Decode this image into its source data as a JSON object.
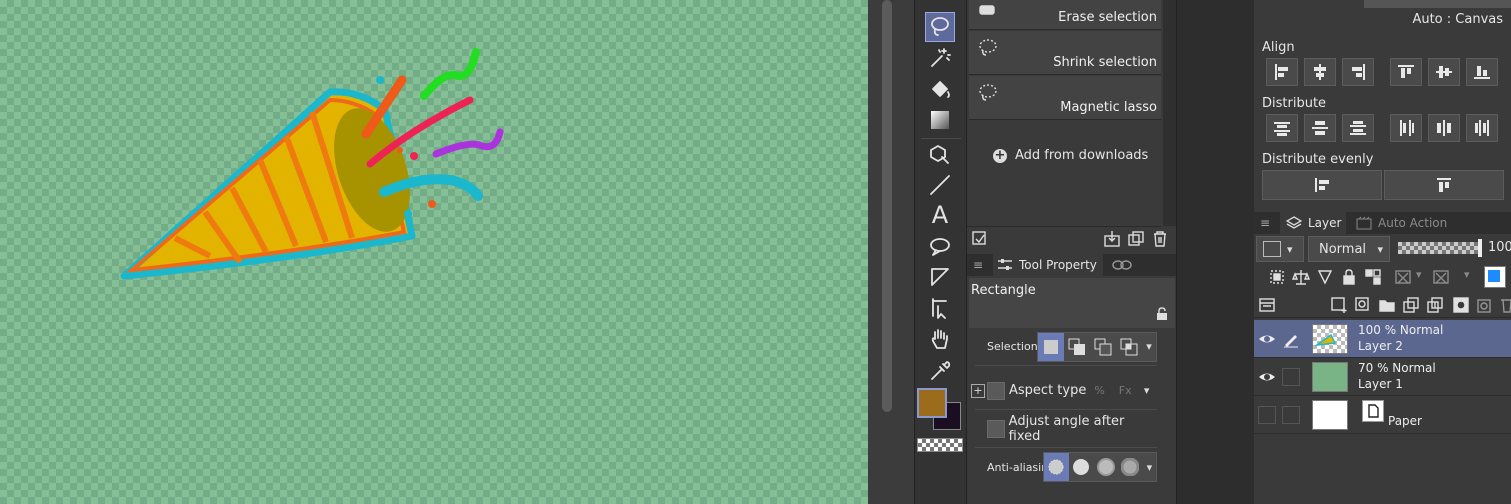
{
  "subtool": {
    "items": [
      {
        "label": "Erase selection"
      },
      {
        "label": "Shrink selection"
      },
      {
        "label": "Magnetic lasso"
      }
    ],
    "add_from_downloads": "Add from downloads"
  },
  "tool_property": {
    "tab_label": "Tool Property",
    "title": "Rectangle",
    "selection_mode_label": "Selection m",
    "aspect_type_label": "Aspect type",
    "adjust_angle_label": "Adjust angle after fixed",
    "anti_aliasing_label": "Anti-aliasin"
  },
  "align_panel": {
    "mode_text": "Auto : Canvas",
    "align_label": "Align",
    "distribute_label": "Distribute",
    "distribute_evenly_label": "Distribute evenly"
  },
  "layer_panel": {
    "tab_layer": "Layer",
    "tab_auto_action": "Auto Action",
    "blend_mode": "Normal",
    "opacity": "100",
    "layers": [
      {
        "mode": "100 % Normal",
        "name": "Layer 2",
        "visible": true,
        "selected": true
      },
      {
        "mode": "70 % Normal",
        "name": "Layer 1",
        "visible": true,
        "selected": false
      },
      {
        "mode": "",
        "name": "Paper",
        "visible": false,
        "selected": false
      }
    ]
  },
  "colors": {
    "main_color": "#9a6c1c",
    "sub_color": "#1a0f22",
    "accent": "#6b7bb5"
  }
}
